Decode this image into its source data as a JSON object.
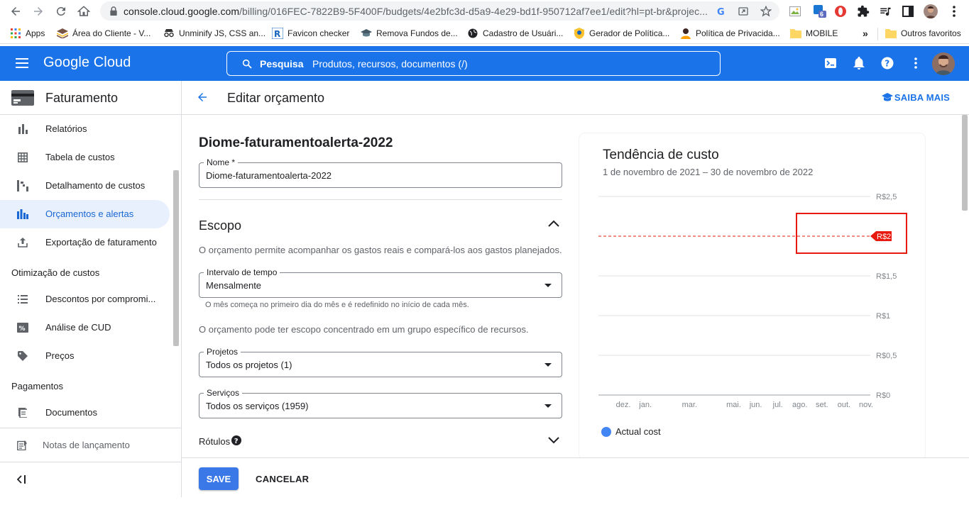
{
  "browser": {
    "url_main": "console.cloud.google.com",
    "url_rest": "/billing/016FEC-7822B9-5F400F/budgets/4e2bfc3d-d5a9-4e29-bd1f-950712af7ee1/edit?hl=pt-br&projec...",
    "ext_badge": "6",
    "bookmarks": [
      {
        "label": "Apps",
        "icon": "apps-grid-icon"
      },
      {
        "label": "Área do Cliente - V...",
        "icon": "layers-icon"
      },
      {
        "label": "Unminify JS, CSS an...",
        "icon": "spy-icon"
      },
      {
        "label": "Favicon checker",
        "icon": "r-logo-icon"
      },
      {
        "label": "Remova Fundos de...",
        "icon": "graduation-icon"
      },
      {
        "label": "Cadastro de Usuári...",
        "icon": "globe-icon"
      },
      {
        "label": "Gerador de Política...",
        "icon": "shield-emoji-icon"
      },
      {
        "label": "Política de Privacida...",
        "icon": "person-icon"
      },
      {
        "label": "MOBILE",
        "icon": "folder-icon"
      }
    ],
    "more_bookmarks": "»",
    "other_favorites": "Outros favoritos"
  },
  "header": {
    "logo": "Google Cloud",
    "search_label": "Pesquisa",
    "search_placeholder": "Produtos, recursos, documentos (/)"
  },
  "sidebar": {
    "title": "Faturamento",
    "items": [
      {
        "label": "Relatórios",
        "icon": "bar-chart-icon"
      },
      {
        "label": "Tabela de custos",
        "icon": "table-icon"
      },
      {
        "label": "Detalhamento de custos",
        "icon": "breakdown-icon"
      },
      {
        "label": "Orçamentos e alertas",
        "icon": "budget-icon",
        "active": true
      },
      {
        "label": "Exportação de faturamento",
        "icon": "export-icon"
      }
    ],
    "section_optimization": "Otimização de custos",
    "optimization_items": [
      {
        "label": "Descontos por compromi...",
        "icon": "list-icon"
      },
      {
        "label": "Análise de CUD",
        "icon": "percent-icon"
      },
      {
        "label": "Preços",
        "icon": "tag-icon"
      }
    ],
    "section_payments": "Pagamentos",
    "payment_items": [
      {
        "label": "Documentos",
        "icon": "document-icon"
      }
    ],
    "release_notes": "Notas de lançamento",
    "collapse_icon": "collapse-left-icon"
  },
  "page": {
    "title": "Editar orçamento",
    "learn_more": "SAIBA MAIS"
  },
  "form": {
    "budget_heading": "Diome-faturamentoalerta-2022",
    "name_label": "Nome *",
    "name_value": "Diome-faturamentoalerta-2022",
    "scope_title": "Escopo",
    "scope_desc": "O orçamento permite acompanhar os gastos reais e compará-los aos gastos planejados.",
    "interval_label": "Intervalo de tempo",
    "interval_value": "Mensalmente",
    "interval_hint": "O mês começa no primeiro dia do mês e é redefinido no início de cada mês.",
    "scope_desc2": "O orçamento pode ter escopo concentrado em um grupo específico de recursos.",
    "projects_label": "Projetos",
    "projects_value": "Todos os projetos (1)",
    "services_label": "Serviços",
    "services_value": "Todos os serviços (1959)",
    "labels_title": "Rótulos"
  },
  "chart_data": {
    "type": "line",
    "title": "Tendência de custo",
    "subtitle": "1 de novembro de 2021 – 30 de novembro de 2022",
    "x_ticks": [
      "dez.",
      "jan.",
      "mar.",
      "mai.",
      "jun.",
      "jul.",
      "ago.",
      "set.",
      "out.",
      "nov."
    ],
    "y_ticks": [
      "R$0",
      "R$0,5",
      "R$1",
      "R$1,5",
      "R$2",
      "R$2,5"
    ],
    "ylim": [
      0,
      2.5
    ],
    "budget_line": 2,
    "budget_label": "R$2",
    "series": [
      {
        "name": "Actual cost",
        "values": []
      }
    ],
    "highlight_color": "#e8190e",
    "series_color": "#4285f4",
    "grid": true,
    "legend": "bottom-left"
  },
  "footer": {
    "save": "SAVE",
    "cancel": "CANCELAR"
  },
  "colors": {
    "primary": "#1a73e8",
    "active_bg": "#e8f0fe",
    "save_btn": "#3b78e7"
  }
}
